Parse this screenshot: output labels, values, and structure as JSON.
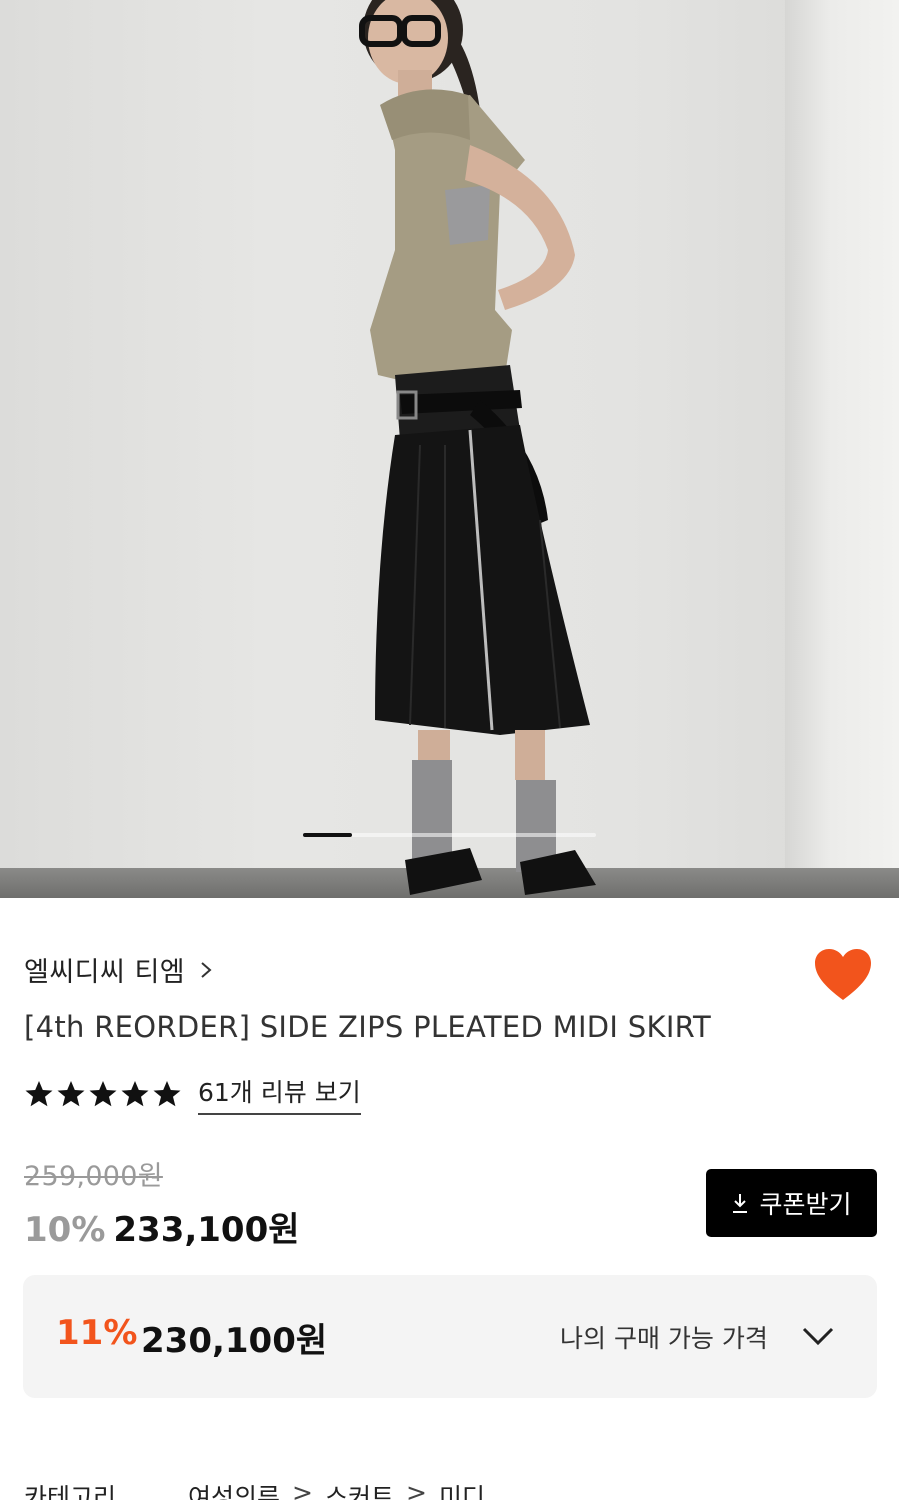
{
  "product": {
    "brand": "엘씨디씨 티엠",
    "title": "[4th REORDER] SIDE ZIPS PLEATED MIDI SKIRT",
    "rating_stars": 5,
    "review_link": "61개 리뷰 보기",
    "original_price": "259,000원",
    "discount_rate": "10%",
    "sale_price": "233,100원",
    "coupon_button": "쿠폰받기",
    "wishlist": true
  },
  "my_price": {
    "discount_rate": "11%",
    "price": "230,100원",
    "label": "나의 구매 가능 가격"
  },
  "gallery": {
    "current_index": 1,
    "image": "model-wearing-black-pleated-skirt"
  },
  "breadcrumb": {
    "label": "카테고리",
    "items": [
      "여성의류",
      "스커트",
      "미디"
    ]
  },
  "colors": {
    "accent": "#f2541c",
    "button_bg": "#000000",
    "box_bg": "#f4f4f4"
  },
  "icons": [
    "chevron-right-icon",
    "heart-icon",
    "star-icon",
    "download-icon",
    "chevron-down-icon"
  ]
}
